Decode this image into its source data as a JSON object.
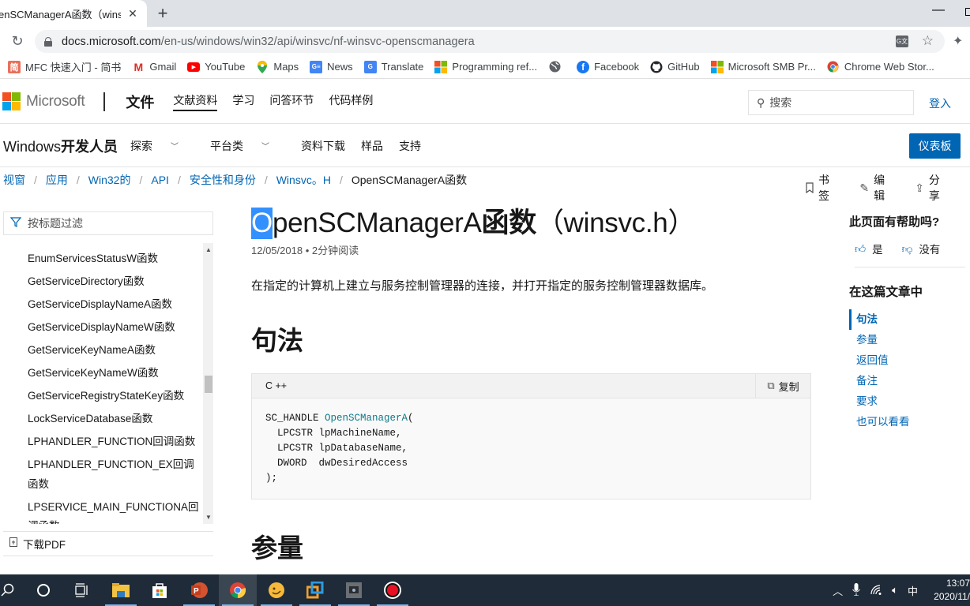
{
  "browser": {
    "tab_title": "OpenSCManagerA函数（winsvc.h）",
    "tab_title_visible": "enSCManagerA函数（winsv",
    "url_host": "docs.microsoft.com",
    "url_path": "/en-us/windows/win32/api/winsvc/nf-winsvc-openscmanagera",
    "bookmarks": [
      {
        "label": "MFC 快速入门 - 简书",
        "icon": "jianshu-icon",
        "color": "#ea6f5a",
        "glyph": "简"
      },
      {
        "label": "Gmail",
        "icon": "gmail-icon",
        "color": "#ffffff",
        "glyph": "M"
      },
      {
        "label": "YouTube",
        "icon": "youtube-icon",
        "color": "#ff0000",
        "glyph": "▶"
      },
      {
        "label": "Maps",
        "icon": "maps-icon",
        "color": "#ffffff",
        "glyph": "📍"
      },
      {
        "label": "News",
        "icon": "news-icon",
        "color": "#4285f4",
        "glyph": "G"
      },
      {
        "label": "Translate",
        "icon": "translate-icon",
        "color": "#4285f4",
        "glyph": "G"
      },
      {
        "label": "Programming ref...",
        "icon": "microsoft-icon",
        "color": "",
        "glyph": ""
      },
      {
        "label": "",
        "icon": "globe-icon",
        "color": "#5f6368",
        "glyph": "🌐"
      },
      {
        "label": "Facebook",
        "icon": "facebook-icon",
        "color": "#1877f2",
        "glyph": "f"
      },
      {
        "label": "GitHub",
        "icon": "github-icon",
        "color": "#24292e",
        "glyph": "●"
      },
      {
        "label": "Microsoft SMB Pr...",
        "icon": "microsoft-icon",
        "color": "",
        "glyph": ""
      },
      {
        "label": "Chrome Web Stor...",
        "icon": "chrome-web-store-icon",
        "color": "",
        "glyph": ""
      }
    ]
  },
  "header": {
    "logo_text": "Microsoft",
    "brand": "文件",
    "nav": [
      "文献资料",
      "学习",
      "问答环节",
      "代码样例"
    ],
    "search_placeholder": "搜索",
    "signin": "登入"
  },
  "subheader": {
    "title_latin": "Windows",
    "title_cjk": "开发人员",
    "nav": [
      {
        "label": "探索",
        "dropdown": true
      },
      {
        "label": "平台类",
        "dropdown": true
      },
      {
        "label": "资料下载",
        "dropdown": false
      },
      {
        "label": "样品",
        "dropdown": false
      },
      {
        "label": "支持",
        "dropdown": false
      }
    ],
    "dashboard": "仪表板"
  },
  "breadcrumb": [
    "视窗",
    "应用",
    "Win32的",
    "API",
    "安全性和身份",
    "Winsvc。H",
    "OpenSCManagerA函数"
  ],
  "actions": [
    "书签",
    "编辑",
    "分享"
  ],
  "toc": {
    "filter_placeholder": "按标题过滤",
    "items": [
      "EnumServicesStatusW函数",
      "GetServiceDirectory函数",
      "GetServiceDisplayNameA函数",
      "GetServiceDisplayNameW函数",
      "GetServiceKeyNameA函数",
      "GetServiceKeyNameW函数",
      "GetServiceRegistryStateKey函数",
      "LockServiceDatabase函数",
      "LPHANDLER_FUNCTION回调函数",
      "LPHANDLER_FUNCTION_EX回调函数",
      "LPSERVICE_MAIN_FUNCTIONA回调函数"
    ],
    "download_pdf": "下载PDF"
  },
  "article": {
    "title_sel": "O",
    "title_latin": "penSCManagerA",
    "title_cjk": "函数",
    "title_suffix": "（winsvc.h）",
    "date": "12/05/2018",
    "read_time": "2分钟阅读",
    "description": "在指定的计算机上建立与服务控制管理器的连接，并打开指定的服务控制管理器数据库。",
    "syntax_heading": "句法",
    "code_lang": "C ++",
    "copy_label": "复制",
    "code_prefix": "SC_HANDLE ",
    "code_fn": "OpenSCManagerA",
    "code_body": "(\n  LPCSTR lpMachineName,\n  LPCSTR lpDatabaseName,\n  DWORD  dwDesiredAccess\n);",
    "params_heading": "参量",
    "first_param": "lpMachineName"
  },
  "rail": {
    "helpful_q": "此页面有帮助吗?",
    "yes": "是",
    "no": "没有",
    "in_this_article": "在这篇文章中",
    "sections": [
      "句法",
      "参量",
      "返回值",
      "备注",
      "要求",
      "也可以看看"
    ],
    "active_section": 0
  },
  "taskbar": {
    "apps": [
      "search-icon",
      "cortana-icon",
      "task-view-icon",
      "file-explorer-icon",
      "store-icon",
      "powerpoint-icon",
      "chrome-icon",
      "app-icon",
      "app-icon",
      "app-icon",
      "record-icon"
    ],
    "tray": {
      "ime": "中",
      "time": "13:07",
      "date": "2020/11/"
    }
  }
}
